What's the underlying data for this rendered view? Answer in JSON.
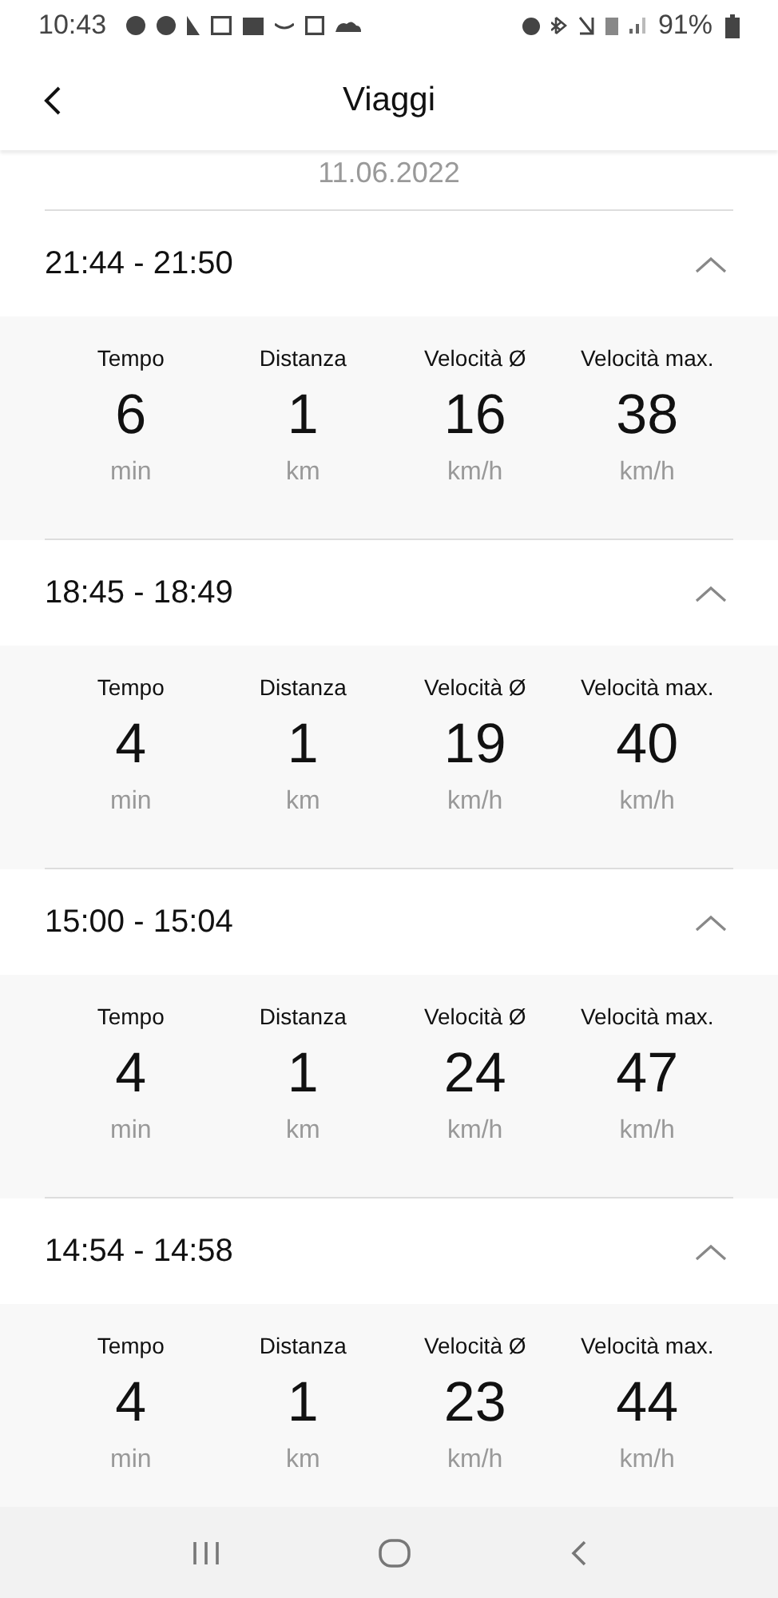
{
  "status_bar": {
    "time": "10:43",
    "battery": "91%"
  },
  "header": {
    "title": "Viaggi"
  },
  "date": "11.06.2022",
  "trips": [
    {
      "time_range": "21:44 - 21:50",
      "expanded": true,
      "stats": [
        {
          "label": "Tempo",
          "value": "6",
          "unit": "min"
        },
        {
          "label": "Distanza",
          "value": "1",
          "unit": "km"
        },
        {
          "label": "Velocità Ø",
          "value": "16",
          "unit": "km/h"
        },
        {
          "label": "Velocità max.",
          "value": "38",
          "unit": "km/h"
        }
      ]
    },
    {
      "time_range": "18:45 - 18:49",
      "expanded": true,
      "stats": [
        {
          "label": "Tempo",
          "value": "4",
          "unit": "min"
        },
        {
          "label": "Distanza",
          "value": "1",
          "unit": "km"
        },
        {
          "label": "Velocità Ø",
          "value": "19",
          "unit": "km/h"
        },
        {
          "label": "Velocità max.",
          "value": "40",
          "unit": "km/h"
        }
      ]
    },
    {
      "time_range": "15:00 - 15:04",
      "expanded": true,
      "stats": [
        {
          "label": "Tempo",
          "value": "4",
          "unit": "min"
        },
        {
          "label": "Distanza",
          "value": "1",
          "unit": "km"
        },
        {
          "label": "Velocità Ø",
          "value": "24",
          "unit": "km/h"
        },
        {
          "label": "Velocità max.",
          "value": "47",
          "unit": "km/h"
        }
      ]
    },
    {
      "time_range": "14:54 - 14:58",
      "expanded": true,
      "stats": [
        {
          "label": "Tempo",
          "value": "4",
          "unit": "min"
        },
        {
          "label": "Distanza",
          "value": "1",
          "unit": "km"
        },
        {
          "label": "Velocità Ø",
          "value": "23",
          "unit": "km/h"
        },
        {
          "label": "Velocità max.",
          "value": "44",
          "unit": "km/h"
        }
      ]
    }
  ]
}
